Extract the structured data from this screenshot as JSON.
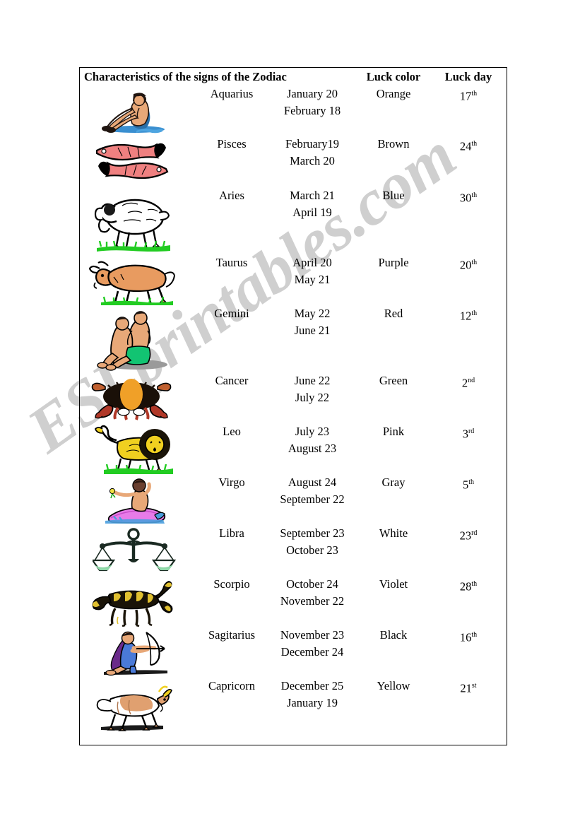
{
  "document": {
    "title": "Characteristics of the signs of the Zodiac",
    "watermark": "ESLprintables.com",
    "watermark_color": "#cfcfcf",
    "border_color": "#000000",
    "background": "#ffffff"
  },
  "table": {
    "headers": {
      "title": "Characteristics of the signs of the Zodiac",
      "luck_color": "Luck color",
      "luck_day": "Luck day"
    },
    "rows": [
      {
        "icon": "aquarius-icon",
        "sign": "Aquarius",
        "date_start": "January 20",
        "date_end": "February 18",
        "luck_color": "Orange",
        "luck_day_number": "17",
        "luck_day_suffix": "th"
      },
      {
        "icon": "pisces-icon",
        "sign": "Pisces",
        "date_start": "February19",
        "date_end": "March 20",
        "luck_color": "Brown",
        "luck_day_number": "24",
        "luck_day_suffix": "th"
      },
      {
        "icon": "aries-icon",
        "sign": "Aries",
        "date_start": "March 21",
        "date_end": "April 19",
        "luck_color": "Blue",
        "luck_day_number": "30",
        "luck_day_suffix": "th"
      },
      {
        "icon": "taurus-icon",
        "sign": "Taurus",
        "date_start": "April 20",
        "date_end": "May 21",
        "luck_color": "Purple",
        "luck_day_number": "20",
        "luck_day_suffix": "th"
      },
      {
        "icon": "gemini-icon",
        "sign": "Gemini",
        "date_start": "May 22",
        "date_end": "June 21",
        "luck_color": "Red",
        "luck_day_number": "12",
        "luck_day_suffix": "th"
      },
      {
        "icon": "cancer-icon",
        "sign": "Cancer",
        "date_start": "June 22",
        "date_end": "July 22",
        "luck_color": "Green",
        "luck_day_number": "2",
        "luck_day_suffix": "nd"
      },
      {
        "icon": "leo-icon",
        "sign": "Leo",
        "date_start": "July 23",
        "date_end": "August 23",
        "luck_color": "Pink",
        "luck_day_number": "3",
        "luck_day_suffix": "rd"
      },
      {
        "icon": "virgo-icon",
        "sign": "Virgo",
        "date_start": "August 24",
        "date_end": "September 22",
        "luck_color": "Gray",
        "luck_day_number": "5",
        "luck_day_suffix": "th"
      },
      {
        "icon": "libra-icon",
        "sign": "Libra",
        "date_start": "September 23",
        "date_end": "October 23",
        "luck_color": "White",
        "luck_day_number": "23",
        "luck_day_suffix": "rd"
      },
      {
        "icon": "scorpio-icon",
        "sign": "Scorpio",
        "date_start": "October 24",
        "date_end": "November 22",
        "luck_color": "Violet",
        "luck_day_number": "28",
        "luck_day_suffix": "th"
      },
      {
        "icon": "sagitarius-icon",
        "sign": "Sagitarius",
        "date_start": "November 23",
        "date_end": "December 24",
        "luck_color": "Black",
        "luck_day_number": "16",
        "luck_day_suffix": "th"
      },
      {
        "icon": "capricorn-icon",
        "sign": "Capricorn",
        "date_start": "December 25",
        "date_end": "January 19",
        "luck_color": "Yellow",
        "luck_day_number": "21",
        "luck_day_suffix": "st"
      }
    ]
  },
  "icon_colors": {
    "aquarius_skin": "#e8a878",
    "aquarius_water": "#3a8fd0",
    "aquarius_hair": "#201510",
    "pisces_body": "#ef8080",
    "aries_body": "#ffffff",
    "aries_grass": "#22cc22",
    "taurus_body": "#e89b60",
    "taurus_grass": "#22cc22",
    "gemini_skin": "#e8a878",
    "gemini_cloth": "#12c472",
    "cancer_body": "#f0a028",
    "cancer_claw": "#b03828",
    "leo_body": "#f0d020",
    "virgo_dress": "#e87be8",
    "virgo_accent": "#4a9ede",
    "libra_pan": "#8fd8a8",
    "scorpio_body": "#e0c030",
    "sagitarius_cloak": "#6a2a8a",
    "sagitarius_tunic": "#4a7ad8",
    "capricorn_body": "#e0a070",
    "outline": "#000000"
  }
}
